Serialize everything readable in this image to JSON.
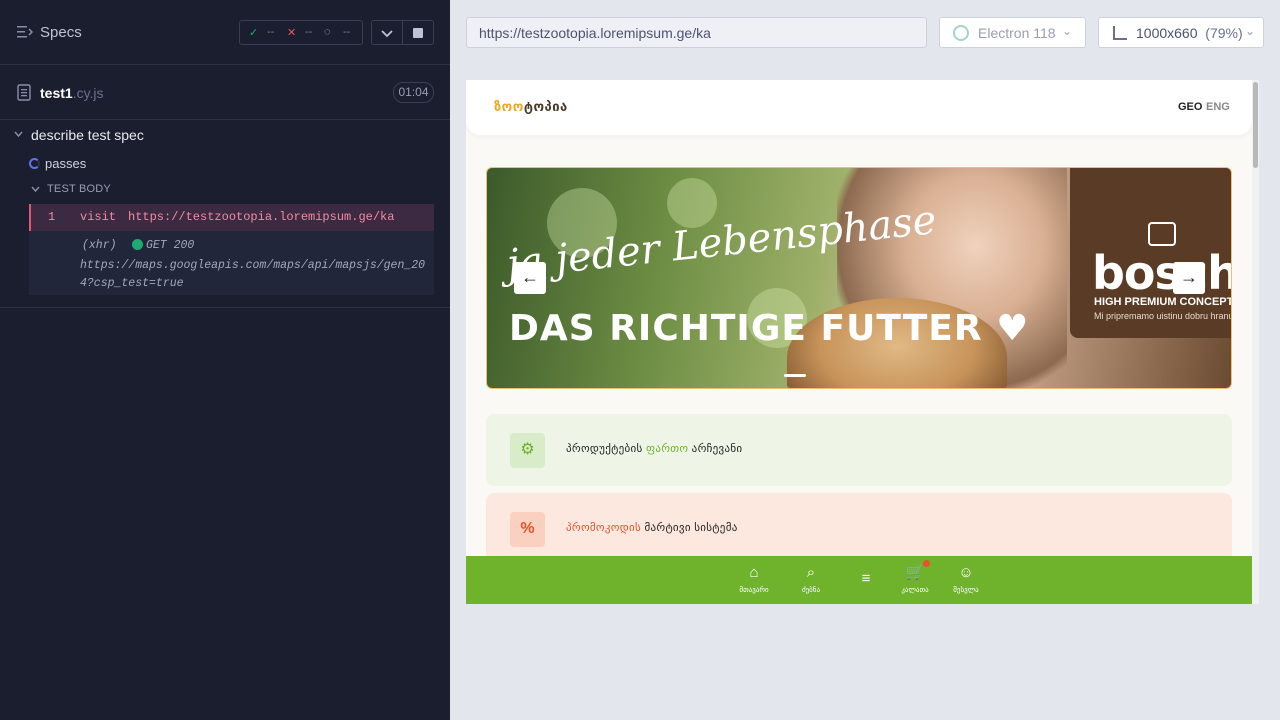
{
  "reporter": {
    "title": "Specs",
    "stats": {
      "passed": "--",
      "failed": "--",
      "pending": "--"
    },
    "spec_file": {
      "name": "test1",
      "ext": ".cy.js",
      "duration": "01:04"
    },
    "suite": {
      "title": "describe test spec",
      "test": {
        "name": "passes"
      },
      "body_label": "TEST BODY",
      "commands": [
        {
          "number": "1",
          "name": "visit",
          "arg": "https://testzootopia.loremipsum.ge/ka"
        }
      ],
      "xhr": {
        "type": "(xhr)",
        "status": "GET 200",
        "url": "https://maps.googleapis.com/maps/api/mapsjs/gen_204?csp_test=true"
      }
    }
  },
  "runner": {
    "url": "https://testzootopia.loremipsum.ge/ka",
    "browser": "Electron 118",
    "viewport": {
      "size": "1000x660",
      "scale": "(79%)"
    }
  },
  "site": {
    "logo": {
      "part1": "ზოო",
      "part2": "ტოპია"
    },
    "lang": {
      "geo": "GEO",
      "eng": "ENG"
    },
    "banner": {
      "script_text": "ja jeder Lebensphase",
      "caps_text": "DAS RICHTIGE FUTTER ♥",
      "brand": "bosch",
      "brand_sub": "HIGH PREMIUM CONCEPT",
      "brand_tag": "Mi pripremamo uistinu dobru hranu",
      "prev": "←",
      "next": "→"
    },
    "features": [
      {
        "icon": "⚙",
        "pre": "პროდუქტების ",
        "highlight": "ფართო",
        "post": " არჩევანი"
      },
      {
        "icon": "%",
        "pre": "",
        "highlight": "პრომოკოდის",
        "post": " მარტივი სისტემა"
      }
    ],
    "nav": [
      {
        "icon": "⌂",
        "label": "მთავარი"
      },
      {
        "icon": "⌕",
        "label": "ძებნა"
      },
      {
        "icon": "≡",
        "label": ""
      },
      {
        "icon": "🛒",
        "label": "კალათა"
      },
      {
        "icon": "☺",
        "label": "შესვლა"
      }
    ]
  },
  "colors": {
    "reporter_bg": "#1b1e2e",
    "pass": "#1fa971",
    "fail": "#e45770",
    "site_green": "#6fb22c",
    "accent_red": "#e2562a"
  }
}
